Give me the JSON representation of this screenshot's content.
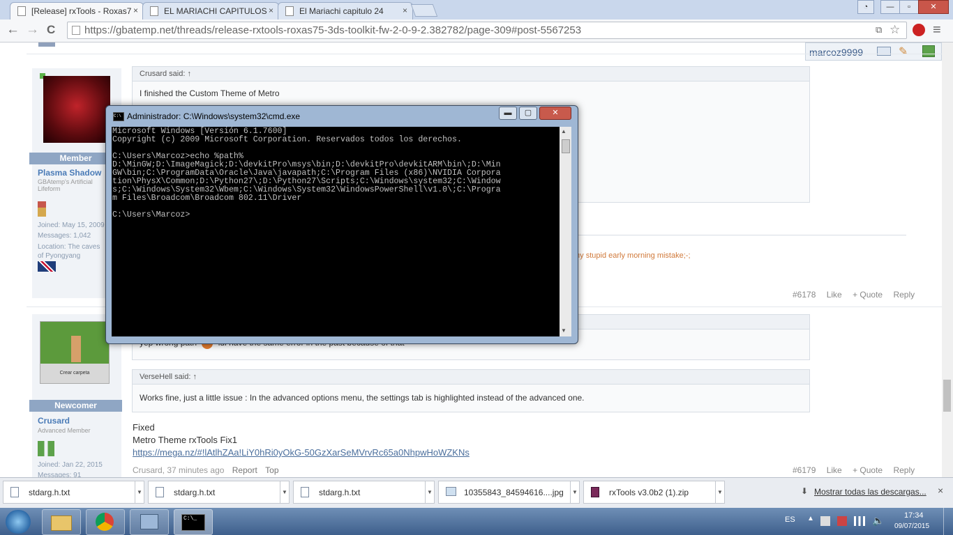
{
  "browser": {
    "tabs": [
      {
        "label": "[Release] rxTools - Roxas7",
        "close": "×"
      },
      {
        "label": "EL MARIACHI CAPITULOS",
        "close": "×"
      },
      {
        "label": "El Mariachi capitulo 24",
        "close": "×"
      }
    ],
    "url": "https://gbatemp.net/threads/release-rxtools-roxas75-3ds-toolkit-fw-2-0-9-2.382782/page-309#post-5567253",
    "nav": {
      "back": "←",
      "forward": "→",
      "reload": "C",
      "menu": "≡",
      "star": "☆"
    },
    "window_controls": {
      "minimize": "—",
      "restore": "▫",
      "close": "✕"
    }
  },
  "site": {
    "user": "marcoz9999"
  },
  "posts": [
    {
      "quote_author": "Crusard said:",
      "quote_link": "↑",
      "quote_text": "I finished the Custom Theme of Metro",
      "banner": "Member",
      "username": "Plasma Shadow",
      "user_title": "GBAtemp's Artificial Lifeform",
      "joined_label": "Joined:",
      "joined": "May 15, 2009",
      "messages_label": "Messages:",
      "messages": "1,042",
      "location_label": "Location:",
      "location": "The caves of Pyongyang",
      "extra_text": "my stupid early morning mistake;-;",
      "number": "#6178",
      "like": "Like",
      "quote": "+ Quote",
      "reply": "Reply"
    },
    {
      "quote_text": "yep wrong path",
      "quote_text2": "idl have the same error in the past because of that",
      "quote2_author": "VerseHell said:",
      "quote2_link": "↑",
      "quote2_text": "Works fine, just a little issue : In the advanced options menu, the settings tab is highlighted instead of the advanced one.",
      "avatar_caption": "Crear carpeta",
      "banner": "Newcomer",
      "username": "Crusard",
      "user_title": "Advanced Member",
      "joined_label": "Joined:",
      "joined": "Jan 22, 2015",
      "messages_label": "Messages:",
      "messages": "91",
      "body_line1": "Fixed",
      "body_line2": "Metro Theme rxTools Fix1",
      "body_link": "https://mega.nz/#!lAtlhZAa!LiY0hRi0yOkG-50GzXarSeMVrvRc65a0NhpwHoWZKNs",
      "meta_author": "Crusard,",
      "meta_time": "37 minutes ago",
      "report": "Report",
      "top": "Top",
      "number": "#6179",
      "like": "Like",
      "quote": "+ Quote",
      "reply": "Reply"
    }
  ],
  "cmd": {
    "title": "Administrador: C:\\Windows\\system32\\cmd.exe",
    "output": "Microsoft Windows [Versión 6.1.7600]\nCopyright (c) 2009 Microsoft Corporation. Reservados todos los derechos.\n\nC:\\Users\\Marcoz>echo %path%\nD:\\MinGW;D:\\ImageMagick;D:\\devkitPro\\msys\\bin;D:\\devkitPro\\devkitARM\\bin\\;D:\\Min\nGW\\bin;C:\\ProgramData\\Oracle\\Java\\javapath;C:\\Program Files (x86)\\NVIDIA Corpora\ntion\\PhysX\\Common;D:\\Python27\\;D:\\Python27\\Scripts;C:\\Windows\\system32;C:\\Window\ns;C:\\Windows\\System32\\Wbem;C:\\Windows\\System32\\WindowsPowerShell\\v1.0\\;C:\\Progra\nm Files\\Broadcom\\Broadcom 802.11\\Driver\n\nC:\\Users\\Marcoz>",
    "icon_text": "C:\\"
  },
  "downloads": {
    "items": [
      {
        "name": "stdarg.h.txt"
      },
      {
        "name": "stdarg.h.txt"
      },
      {
        "name": "stdarg.h.txt"
      },
      {
        "name": "10355843_84594616....jpg"
      },
      {
        "name": "rxTools v3.0b2 (1).zip"
      }
    ],
    "show_all": "Mostrar todas las descargas...",
    "close": "×"
  },
  "taskbar": {
    "lang": "ES",
    "time": "17:34",
    "date": "09/07/2015",
    "cmd_icon_text": "C:\\_"
  }
}
